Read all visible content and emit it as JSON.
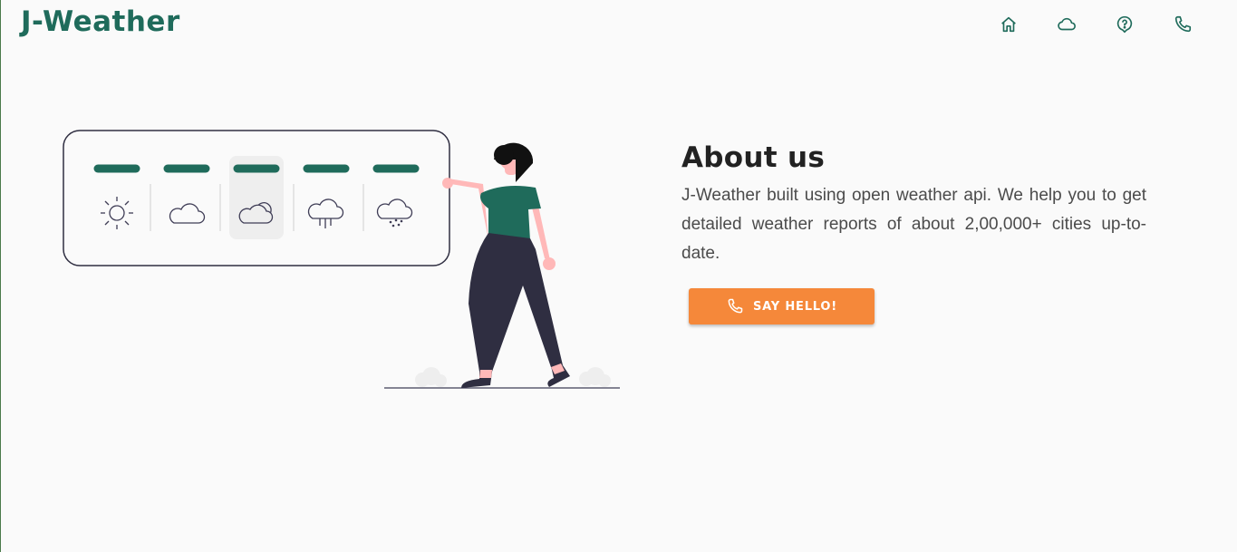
{
  "header": {
    "brand": "J-Weather",
    "nav": [
      {
        "icon": "home-icon"
      },
      {
        "icon": "cloud-icon"
      },
      {
        "icon": "help-icon"
      },
      {
        "icon": "phone-icon"
      }
    ]
  },
  "colors": {
    "brand": "#1f6b5b",
    "accent": "#f5883a",
    "background": "#fafafa",
    "heading": "#222222",
    "body_text": "#4b4b4b"
  },
  "about": {
    "title": "About us",
    "description": "J-Weather built using open weather api. We help you to get detailed weather reports of about 2,00,000+ cities up-to-date.",
    "cta_label": "SAY HELLO!",
    "cta_icon": "phone-icon"
  },
  "illustration": {
    "forecast_icons": [
      "sun-icon",
      "cloud-icon",
      "partly-cloudy-icon",
      "rain-icon",
      "snow-icon"
    ],
    "highlighted_index": 2
  }
}
